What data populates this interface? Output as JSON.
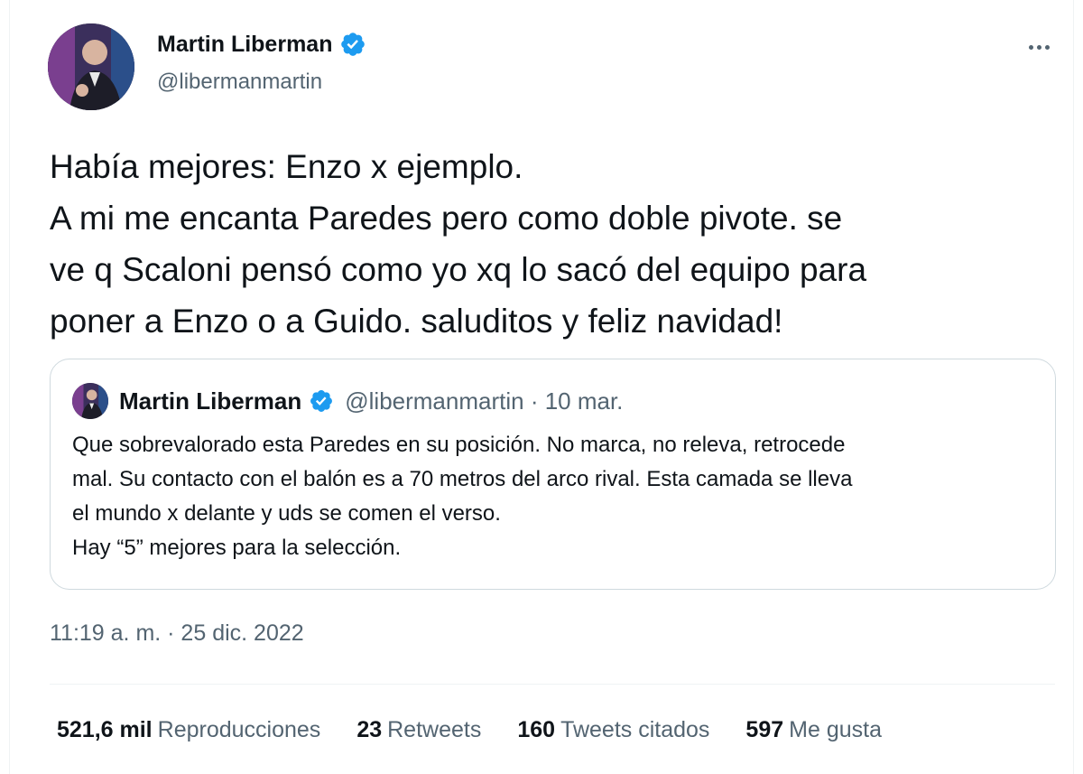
{
  "author": {
    "name": "Martin Liberman",
    "handle": "@libermanmartin"
  },
  "tweet": {
    "lines": [
      "Había mejores: Enzo x ejemplo.",
      "A mi me encanta Paredes pero como doble pivote. se",
      "ve q Scaloni pensó como yo xq lo sacó del equipo para",
      "poner a Enzo o a Guido. saluditos y feliz navidad!"
    ],
    "timestamp": "11:19 a. m. · 25 dic. 2022"
  },
  "quoted": {
    "name": "Martin Liberman",
    "handle_date": "@libermanmartin · 10 mar.",
    "lines": [
      "Que sobrevalorado esta Paredes en su posición. No marca, no releva, retrocede",
      "mal. Su contacto con el balón es a 70 metros del arco rival. Esta camada se lleva",
      "el mundo x delante y uds se comen el verso.",
      "Hay “5” mejores para la selección."
    ]
  },
  "stats": {
    "views": {
      "count": "521,6 mil",
      "label": "Reproducciones"
    },
    "retweets": {
      "count": "23",
      "label": "Retweets"
    },
    "quotes": {
      "count": "160",
      "label": "Tweets citados"
    },
    "likes": {
      "count": "597",
      "label": "Me gusta"
    }
  },
  "icons": {
    "verified": "verified-badge-icon",
    "more": "more-options-icon"
  },
  "colors": {
    "verified": "#1d9bf0",
    "secondary_text": "#536471",
    "primary_text": "#0f1419",
    "border": "#cfd9de"
  }
}
